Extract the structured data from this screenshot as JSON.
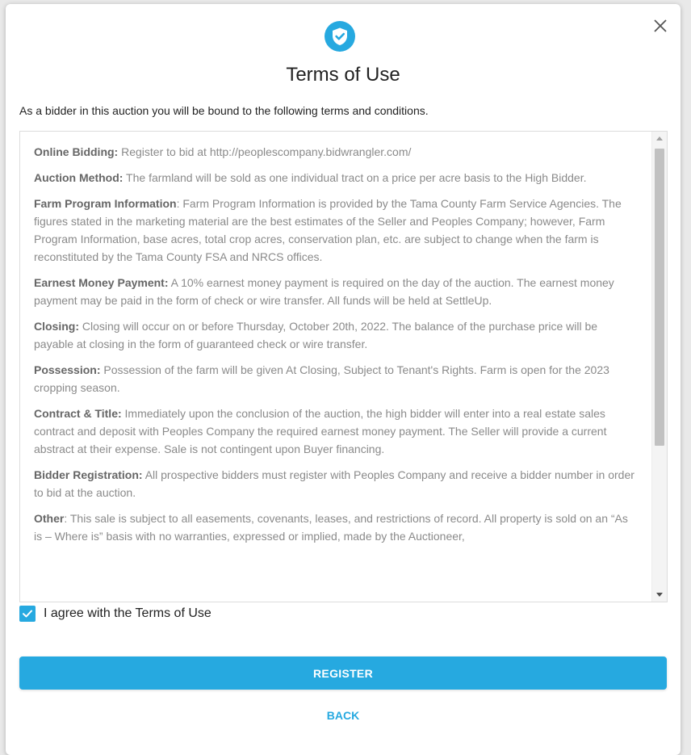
{
  "dialog": {
    "title": "Terms of Use",
    "intro": "As a bidder in this auction you will be bound to the following terms and conditions."
  },
  "terms": [
    {
      "heading": "Online Bidding:",
      "text": " Register to bid at http://peoplescompany.bidwrangler.com/"
    },
    {
      "heading": "Auction Method:",
      "text": " The farmland will be sold as one individual tract on a price per acre basis to the High Bidder."
    },
    {
      "heading": "Farm Program Information",
      "text": ": Farm Program Information is provided by the Tama County Farm Service Agencies. The figures stated in the marketing material are the best estimates of the Seller and Peoples Company; however, Farm Program Information, base acres, total crop acres, conservation plan, etc. are subject to change when the farm is reconstituted by the Tama County FSA and NRCS offices."
    },
    {
      "heading": "Earnest Money Payment:",
      "text": " A 10% earnest money payment is required on the day of the auction. The earnest money payment may be paid in the form of check or wire transfer. All funds will be held at SettleUp."
    },
    {
      "heading": "Closing:",
      "text": " Closing will occur on or before Thursday, October 20th, 2022. The balance of the purchase price will be payable at closing in the form of guaranteed check or wire transfer."
    },
    {
      "heading": "Possession:",
      "text": " Possession of the farm will be given At Closing, Subject to Tenant's Rights. Farm is open for the 2023 cropping season."
    },
    {
      "heading": "Contract & Title:",
      "text": " Immediately upon the conclusion of the auction, the high bidder will enter into a real estate sales contract and deposit with Peoples Company the required earnest money payment. The Seller will provide a current abstract at their expense. Sale is not contingent upon Buyer financing."
    },
    {
      "heading": "Bidder Registration:",
      "text": " All prospective bidders must register with Peoples Company and receive a bidder number in order to bid at the auction."
    },
    {
      "heading": "Other",
      "text": ": This sale is subject to all easements, covenants, leases, and restrictions of record. All property is sold on an “As is – Where is” basis with no warranties, expressed or implied, made by the Auctioneer,"
    }
  ],
  "agree": {
    "label": "I agree with the Terms of Use",
    "checked": true
  },
  "actions": {
    "register_label": "REGISTER",
    "back_label": "BACK"
  },
  "colors": {
    "accent": "#26a9e0"
  },
  "icons": {
    "close": "close-icon",
    "shield": "shield-check-icon",
    "checkbox": "checkmark-icon"
  }
}
